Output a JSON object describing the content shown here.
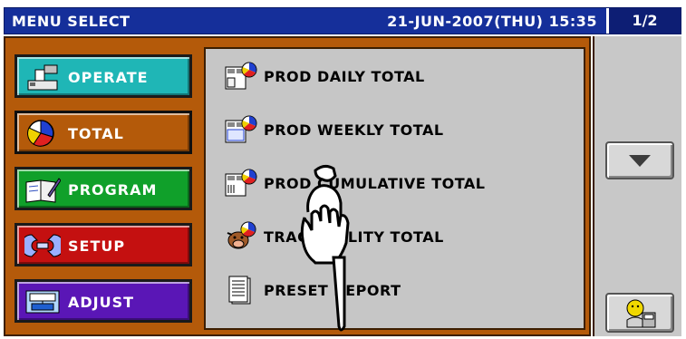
{
  "header": {
    "title": "MENU SELECT",
    "datetime": "21-JUN-2007(THU) 15:35",
    "page_indicator": "1/2"
  },
  "categories": [
    {
      "label": "OPERATE",
      "icon": "cash-register-icon",
      "color": "#1fb6b6"
    },
    {
      "label": "TOTAL",
      "icon": "pie-chart-icon",
      "color": "#b45a0a",
      "selected": true
    },
    {
      "label": "PROGRAM",
      "icon": "book-pencil-icon",
      "color": "#10a02a"
    },
    {
      "label": "SETUP",
      "icon": "wrench-icon",
      "color": "#c41010"
    },
    {
      "label": "ADJUST",
      "icon": "scale-icon",
      "color": "#5a16b6"
    }
  ],
  "menu_items": [
    {
      "label": "PROD DAILY TOTAL",
      "icon": "daily-total-icon"
    },
    {
      "label": "PROD WEEKLY TOTAL",
      "icon": "weekly-total-icon"
    },
    {
      "label": "PROD CUMULATIVE TOTAL",
      "icon": "cumulative-total-icon"
    },
    {
      "label": "TRACEABILITY TOTAL",
      "icon": "traceability-cow-icon"
    },
    {
      "label": "PRESET REPORT",
      "icon": "report-document-icon"
    }
  ],
  "right_panel": {
    "scroll_down_icon": "triangle-down-icon",
    "operator_icon": "operator-user-icon"
  },
  "overlay": {
    "icon": "pointing-hand-icon"
  },
  "colors": {
    "title_bar": "#152f9a",
    "frame": "#b45a0a",
    "content_bg": "#c6c6c6"
  }
}
